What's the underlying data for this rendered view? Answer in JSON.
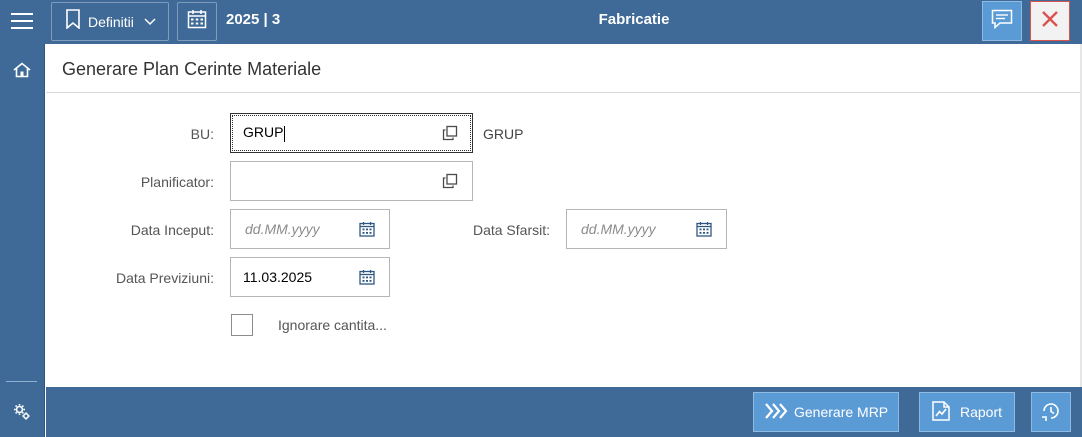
{
  "topbar": {
    "menu_icon": "hamburger-icon",
    "definitions_label": "Definitii",
    "period": "2025 | 3",
    "app_title": "Fabricatie",
    "message_icon": "comment-icon",
    "close_icon": "close-icon"
  },
  "sidebar": {
    "home_icon": "home-icon",
    "settings_icon": "cogs-icon"
  },
  "page": {
    "title": "Generare Plan Cerinte Materiale"
  },
  "form": {
    "bu": {
      "label": "BU:",
      "value": "GRUP",
      "description": "GRUP"
    },
    "planificator": {
      "label": "Planificator:",
      "value": ""
    },
    "data_inceput": {
      "label": "Data Inceput:",
      "placeholder": "dd.MM.yyyy"
    },
    "data_sfarsit": {
      "label": "Data Sfarsit:",
      "placeholder": "dd.MM.yyyy"
    },
    "data_previziuni": {
      "label": "Data Previziuni:",
      "value": "11.03.2025"
    },
    "ignorare": {
      "label": "Ignorare cantita...",
      "checked": false
    }
  },
  "footer": {
    "generate_label": "Generare MRP",
    "report_label": "Raport",
    "history_icon": "history-icon"
  },
  "colors": {
    "shell": "#3f6a97",
    "accent_button": "#5b9bd5",
    "close_border": "#d9534f"
  }
}
